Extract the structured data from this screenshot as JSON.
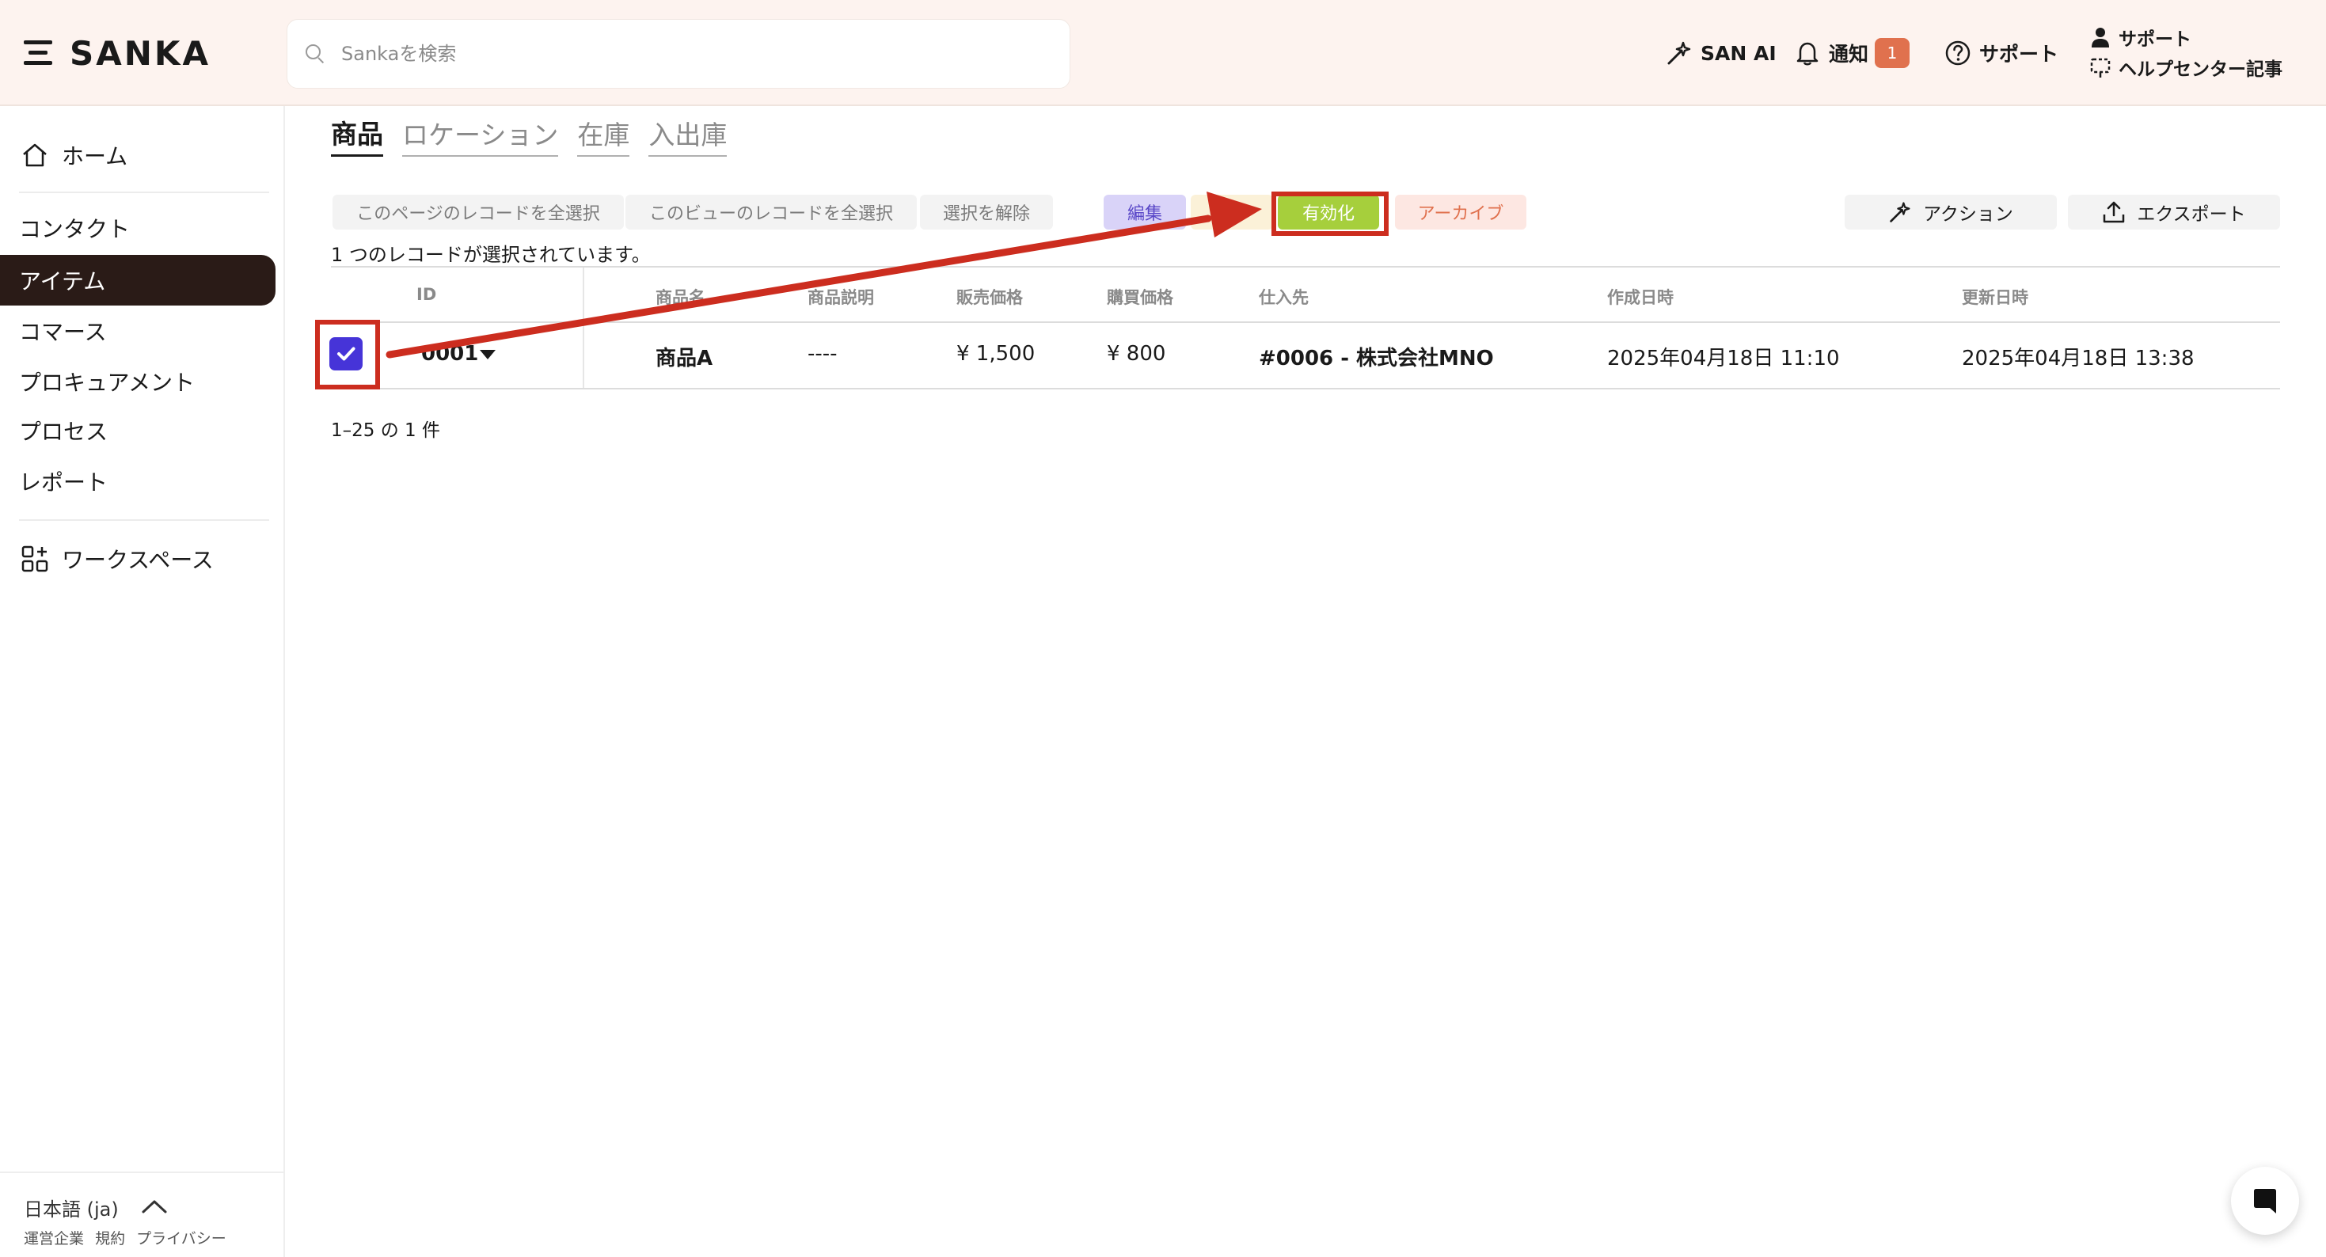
{
  "header": {
    "logo_text": "SANKA",
    "search_placeholder": "Sankaを検索",
    "san_ai_label": "SAN AI",
    "notification_label": "通知",
    "notification_count": "1",
    "support_label": "サポート",
    "support_stack_top": "サポート",
    "support_stack_bottom": "ヘルプセンター記事"
  },
  "sidebar": {
    "home": "ホーム",
    "items": [
      {
        "label": "コンタクト"
      },
      {
        "label": "アイテム"
      },
      {
        "label": "コマース"
      },
      {
        "label": "プロキュアメント"
      },
      {
        "label": "プロセス"
      },
      {
        "label": "レポート"
      }
    ],
    "workspace": "ワークスペース",
    "language": "日本語 (ja)",
    "footer_links": [
      "運営企業",
      "規約",
      "プライバシー"
    ]
  },
  "tabs": [
    {
      "label": "商品"
    },
    {
      "label": "ロケーション"
    },
    {
      "label": "在庫"
    },
    {
      "label": "入出庫"
    }
  ],
  "toolbar": {
    "select_page": "このページのレコードを全選択",
    "select_view": "このビューのレコードを全選択",
    "deselect": "選択を解除",
    "edit": "編集",
    "activate": "有効化",
    "archive": "アーカイブ",
    "action": "アクション",
    "export": "エクスポート"
  },
  "selected_note": "1 つのレコードが選択されています。",
  "table": {
    "columns": [
      "ID",
      "商品名",
      "商品説明",
      "販売価格",
      "購買価格",
      "仕入先",
      "作成日時",
      "更新日時"
    ],
    "rows": [
      {
        "checked": true,
        "id": "0001",
        "name": "商品A",
        "description": "----",
        "sale_price": "¥ 1,500",
        "purchase_price": "¥ 800",
        "supplier": "#0006 - 株式会社MNO",
        "created": "2025年04月18日 11:10",
        "updated": "2025年04月18日 13:38"
      }
    ]
  },
  "pagination": "1–25 の 1 件",
  "colors": {
    "accent": "#4634d8",
    "header_bg": "#fdf3ef",
    "active_nav": "#2a1b17",
    "activate_btn": "#a6cf3c",
    "annotation": "#cc2d1f"
  }
}
